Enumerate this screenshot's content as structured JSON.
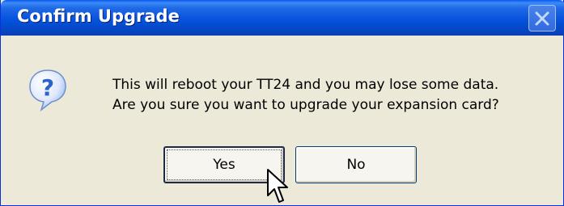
{
  "window": {
    "title": "Confirm Upgrade"
  },
  "icons": {
    "title_close": "close-icon",
    "message": "question-icon",
    "pointer": "mouse-cursor-icon"
  },
  "message": {
    "line1": "This will reboot your TT24 and you may lose some data.",
    "line2": "Are you sure you want to upgrade your expansion card?"
  },
  "buttons": {
    "yes_label": "Yes",
    "no_label": "No"
  },
  "colors": {
    "titlebar": "#0553dd",
    "dialog_bg": "#ece9d8",
    "icon_blue": "#2a63c9"
  }
}
